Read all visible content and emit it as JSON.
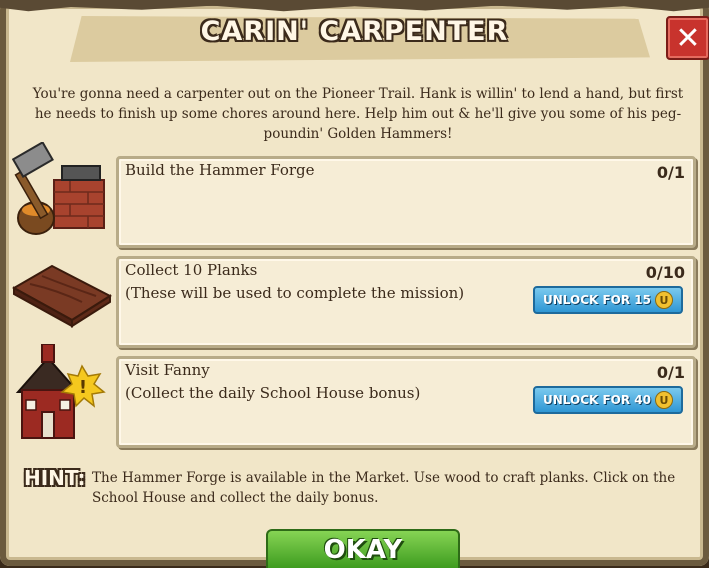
{
  "dialog": {
    "title": "CARIN' CARPENTER",
    "intro": "You're gonna need a carpenter out on the Pioneer Trail. Hank is willin' to lend a hand, but first he needs to finish up some chores around here. Help him out & he'll give you some of his peg-poundin' Golden Hammers!",
    "close_icon": "close-icon",
    "close_symbol": "✕"
  },
  "tasks": [
    {
      "name": "Build the Hammer Forge",
      "description": "",
      "count": "0/1",
      "icon": "hammer-forge-icon"
    },
    {
      "name": "Collect 10 Planks",
      "description": "(These will be used to complete the mission)",
      "count": "0/10",
      "unlock_label": "UNLOCK FOR 15",
      "icon": "wood-plank-icon"
    },
    {
      "name": "Visit Fanny",
      "description": "(Collect the daily School House bonus)",
      "count": "0/1",
      "unlock_label": "UNLOCK FOR 40",
      "icon": "school-house-icon"
    }
  ],
  "hint": {
    "label": "HINT:",
    "text": "The Hammer Forge is available in the Market. Use wood to craft planks. Click on the School House and collect the daily bonus."
  },
  "okay_label": "OKAY",
  "currency_icon": "horseshoe-icon",
  "currency_symbol": "U",
  "colors": {
    "parchment": "#f1e6c8",
    "close_red": "#c8332d",
    "unlock_blue": "#2f97d4",
    "okay_green": "#3e9c1f"
  }
}
